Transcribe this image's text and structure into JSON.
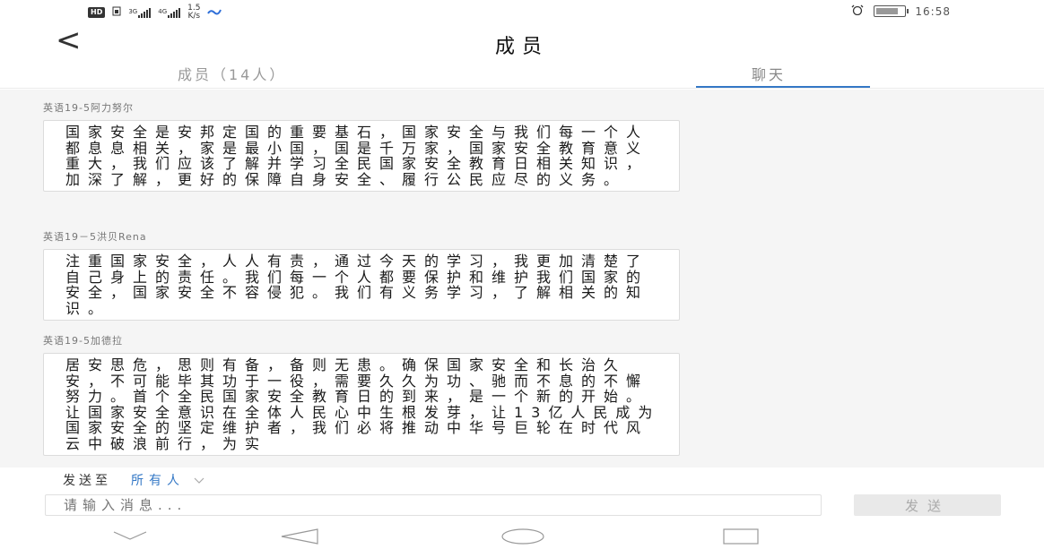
{
  "status_bar": {
    "hd": "HD",
    "sim1": "3G",
    "sim2": "4G",
    "speed_value": "1.5",
    "speed_unit": "K/s",
    "time": "16:58"
  },
  "header": {
    "back_label": "<",
    "title": "成员"
  },
  "tabs": {
    "members_label": "成员（14人）",
    "chat_label": "聊天"
  },
  "messages": [
    {
      "sender": "英语19-5阿力努尔",
      "text": "国家安全是安邦定国的重要基石，国家安全与我们每一个人都息息相关，家是最小国，国是千万家，国家安全教育意义重大，我们应该了解并学习全民国家安全教育日相关知识，加深了解，更好的保障自身安全、履行公民应尽的义务。"
    },
    {
      "sender": "英语19－5洪贝Rena",
      "text": "注重国家安全，人人有责，通过今天的学习，我更加清楚了自己身上的责任。我们每一个人都要保护和维护我们国家的安全，国家安全不容侵犯。我们有义务学习，了解相关的知识。"
    },
    {
      "sender": "英语19-5加德拉",
      "text": "居安思危，思则有备，备则无患。确保国家安全和长治久安，不可能毕其功于一役，需要久久为功、驰而不息的不懈努力。首个全民国家安全教育日的到来，是一个新的开始。让国家安全意识在全体人民心中生根发芽，让13亿人民成为国家安全的坚定维护者，我们必将推动中华号巨轮在时代风云中破浪前行，为实"
    }
  ],
  "send_to": {
    "label": "发送至",
    "target": "所有人"
  },
  "composer": {
    "placeholder": "请输入消息...",
    "send_label": "发送"
  }
}
